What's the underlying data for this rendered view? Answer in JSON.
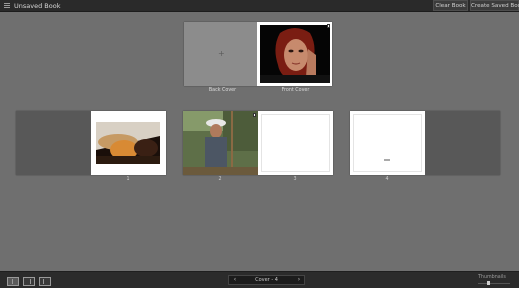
{
  "header": {
    "title": "Unsaved Book",
    "clear_label": "Clear Book",
    "create_label": "Create Saved Book"
  },
  "cover": {
    "back_label": "Back Cover",
    "front_label": "Front Cover",
    "back_placeholder": "+"
  },
  "pages": [
    {
      "number": "1"
    },
    {
      "number": "2"
    },
    {
      "number": "3"
    },
    {
      "number": "4"
    }
  ],
  "footer": {
    "nav_label": "Cover - 4",
    "prev_arrow": "‹",
    "next_arrow": "›",
    "thumbnails_label": "Thumbnails"
  }
}
